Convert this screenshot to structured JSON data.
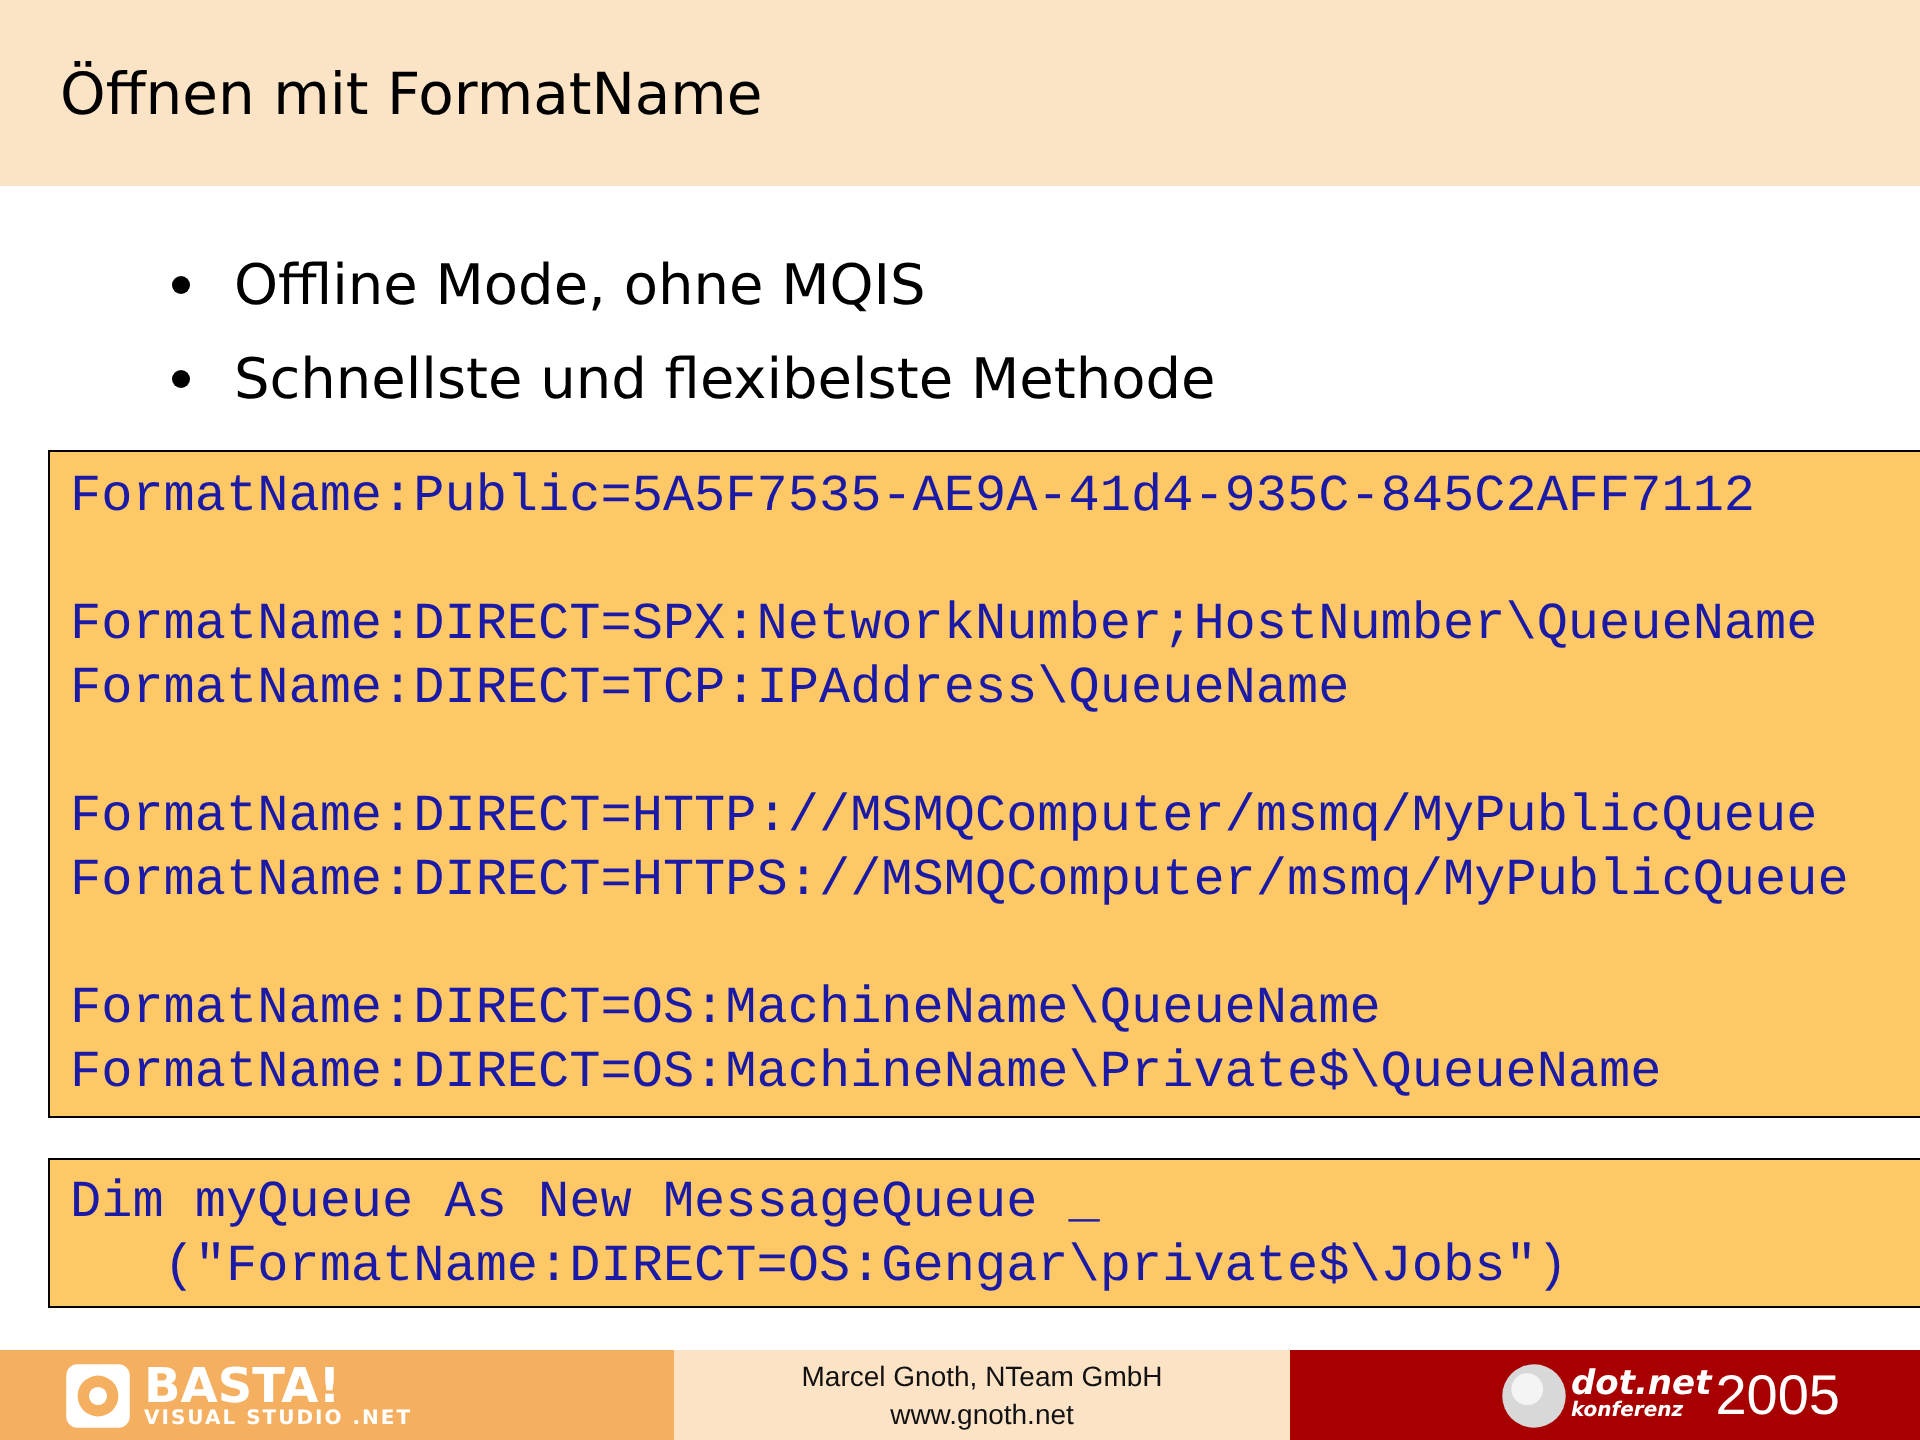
{
  "title": "Öffnen mit FormatName",
  "bullets": [
    "Offline Mode, ohne MQIS",
    "Schnellste und flexibelste Methode"
  ],
  "code_groups": [
    [
      "FormatName:Public=5A5F7535-AE9A-41d4-935C-845C2AFF7112"
    ],
    [
      "FormatName:DIRECT=SPX:NetworkNumber;HostNumber\\QueueName",
      "FormatName:DIRECT=TCP:IPAddress\\QueueName"
    ],
    [
      "FormatName:DIRECT=HTTP://MSMQComputer/msmq/MyPublicQueue",
      "FormatName:DIRECT=HTTPS://MSMQComputer/msmq/MyPublicQueue"
    ],
    [
      "FormatName:DIRECT=OS:MachineName\\QueueName",
      "FormatName:DIRECT=OS:MachineName\\Private$\\QueueName"
    ]
  ],
  "example_code": [
    "Dim myQueue As New MessageQueue _",
    "   (\"FormatName:DIRECT=OS:Gengar\\private$\\Jobs\")"
  ],
  "footer": {
    "left_logo": {
      "name": "BASTA!",
      "subtitle": "VISUAL STUDIO .NET"
    },
    "center_lines": [
      "Marcel Gnoth, NTeam GmbH",
      "www.gnoth.net"
    ],
    "right_logo": {
      "name": "dot.net",
      "subtitle": "konferenz",
      "year": "2005"
    }
  }
}
